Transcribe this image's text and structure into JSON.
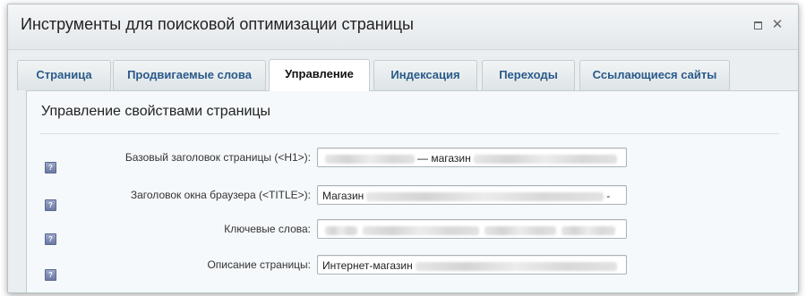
{
  "dialog": {
    "title": "Инструменты для поисковой оптимизации страницы",
    "maximize_icon": "maximize-icon",
    "close_icon": "close-icon",
    "close_glyph": "✕"
  },
  "tabs": [
    {
      "label": "Страница",
      "active": false
    },
    {
      "label": "Продвигаемые слова",
      "active": false
    },
    {
      "label": "Управление",
      "active": true
    },
    {
      "label": "Индексация",
      "active": false
    },
    {
      "label": "Переходы",
      "active": false
    },
    {
      "label": "Ссылающиеся сайты",
      "active": false
    }
  ],
  "panel": {
    "section_title": "Управление свойствами страницы",
    "help_glyph": "?",
    "fields": [
      {
        "label": "Базовый заголовок страницы (<H1>):",
        "visible_text": "— магазин"
      },
      {
        "label": "Заголовок окна браузера (<TITLE>):",
        "visible_text": "Магазин",
        "suffix": "-"
      },
      {
        "label": "Ключевые слова:",
        "visible_text": ""
      },
      {
        "label": "Описание страницы:",
        "visible_text": "Интернет-магазин"
      }
    ]
  }
}
